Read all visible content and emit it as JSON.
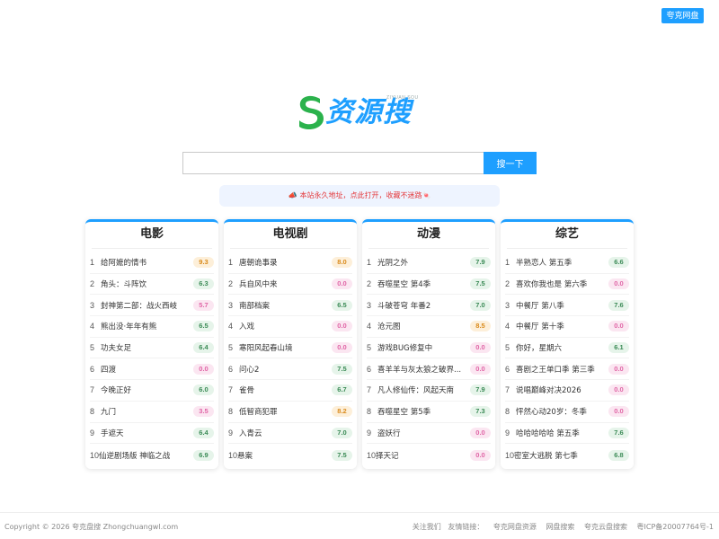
{
  "header": {
    "top_button": "夸克网盘"
  },
  "logo": {
    "text": "资源搜",
    "pinyin": "ZIYUAN SOU"
  },
  "search": {
    "placeholder": "",
    "value": "",
    "button": "搜一下"
  },
  "notice": {
    "icon": "megaphone-icon",
    "text": "本站永久地址，点此打开，收藏不迷路🍬"
  },
  "colors": {
    "accent": "#1e9fff",
    "logo_s": "#2bb24c",
    "notice_text": "#e4393c"
  },
  "cards": [
    {
      "title": "电影",
      "items": [
        {
          "rank": "1",
          "name": "给阿嬷的情书",
          "score": "9.3",
          "tone": "orange"
        },
        {
          "rank": "2",
          "name": "角头：斗阵饮",
          "score": "6.3",
          "tone": "green"
        },
        {
          "rank": "3",
          "name": "封神第二部：战火西岐",
          "score": "5.7",
          "tone": "pink"
        },
        {
          "rank": "4",
          "name": "熊出没·年年有熊",
          "score": "6.5",
          "tone": "green"
        },
        {
          "rank": "5",
          "name": "功夫女足",
          "score": "6.4",
          "tone": "green"
        },
        {
          "rank": "6",
          "name": "四渡",
          "score": "0.0",
          "tone": "pink"
        },
        {
          "rank": "7",
          "name": "今晚正好",
          "score": "6.0",
          "tone": "green"
        },
        {
          "rank": "8",
          "name": "九门",
          "score": "3.5",
          "tone": "pink"
        },
        {
          "rank": "9",
          "name": "手遮天",
          "score": "6.4",
          "tone": "green"
        },
        {
          "rank": "10",
          "name": "仙逆剧场版 神临之战",
          "score": "6.9",
          "tone": "green"
        }
      ]
    },
    {
      "title": "电视剧",
      "items": [
        {
          "rank": "1",
          "name": "唐朝诡事录",
          "score": "8.0",
          "tone": "orange"
        },
        {
          "rank": "2",
          "name": "兵自风中来",
          "score": "0.0",
          "tone": "pink"
        },
        {
          "rank": "3",
          "name": "南部档案",
          "score": "6.5",
          "tone": "green"
        },
        {
          "rank": "4",
          "name": "入戏",
          "score": "0.0",
          "tone": "pink"
        },
        {
          "rank": "5",
          "name": "寒阳风起春山境",
          "score": "0.0",
          "tone": "pink"
        },
        {
          "rank": "6",
          "name": "问心2",
          "score": "7.5",
          "tone": "green"
        },
        {
          "rank": "7",
          "name": "雀骨",
          "score": "6.7",
          "tone": "green"
        },
        {
          "rank": "8",
          "name": "低智商犯罪",
          "score": "8.2",
          "tone": "orange"
        },
        {
          "rank": "9",
          "name": "入青云",
          "score": "7.0",
          "tone": "green"
        },
        {
          "rank": "10",
          "name": "悬案",
          "score": "7.5",
          "tone": "green"
        }
      ]
    },
    {
      "title": "动漫",
      "items": [
        {
          "rank": "1",
          "name": "光阴之外",
          "score": "7.9",
          "tone": "green"
        },
        {
          "rank": "2",
          "name": "吞噬星空 第4季",
          "score": "7.5",
          "tone": "green"
        },
        {
          "rank": "3",
          "name": "斗破苍穹 年番2",
          "score": "7.0",
          "tone": "green"
        },
        {
          "rank": "4",
          "name": "沧元图",
          "score": "8.5",
          "tone": "orange"
        },
        {
          "rank": "5",
          "name": "游戏BUG修复中",
          "score": "0.0",
          "tone": "pink"
        },
        {
          "rank": "6",
          "name": "喜羊羊与灰太狼之破界...",
          "score": "0.0",
          "tone": "pink"
        },
        {
          "rank": "7",
          "name": "凡人修仙传：风起天南",
          "score": "7.9",
          "tone": "green"
        },
        {
          "rank": "8",
          "name": "吞噬星空 第5季",
          "score": "7.3",
          "tone": "green"
        },
        {
          "rank": "9",
          "name": "盗妖行",
          "score": "0.0",
          "tone": "pink"
        },
        {
          "rank": "10",
          "name": "择天记",
          "score": "0.0",
          "tone": "pink"
        }
      ]
    },
    {
      "title": "综艺",
      "items": [
        {
          "rank": "1",
          "name": "半熟恋人 第五季",
          "score": "6.6",
          "tone": "green"
        },
        {
          "rank": "2",
          "name": "喜欢你我也是 第六季",
          "score": "0.0",
          "tone": "pink"
        },
        {
          "rank": "3",
          "name": "中餐厅 第八季",
          "score": "7.6",
          "tone": "green"
        },
        {
          "rank": "4",
          "name": "中餐厅 第十季",
          "score": "0.0",
          "tone": "pink"
        },
        {
          "rank": "5",
          "name": "你好，星期六",
          "score": "6.1",
          "tone": "green"
        },
        {
          "rank": "6",
          "name": "喜剧之王单口季 第三季",
          "score": "0.0",
          "tone": "pink"
        },
        {
          "rank": "7",
          "name": "说唱巅峰对决2026",
          "score": "0.0",
          "tone": "pink"
        },
        {
          "rank": "8",
          "name": "怦然心动20岁：冬季",
          "score": "0.0",
          "tone": "pink"
        },
        {
          "rank": "9",
          "name": "哈哈哈哈哈 第五季",
          "score": "7.6",
          "tone": "green"
        },
        {
          "rank": "10",
          "name": "密室大逃脱 第七季",
          "score": "6.8",
          "tone": "green"
        }
      ]
    }
  ],
  "footer": {
    "copyright": "Copyright © 2026 夸克盘搜 Zhongchuangwl.com",
    "about": "关注我们",
    "friend_label": "友情链接：",
    "links": [
      "夸克网盘资源",
      "网盘搜索",
      "夸克云盘搜索"
    ],
    "icp": "粤ICP备20007764号-1"
  }
}
